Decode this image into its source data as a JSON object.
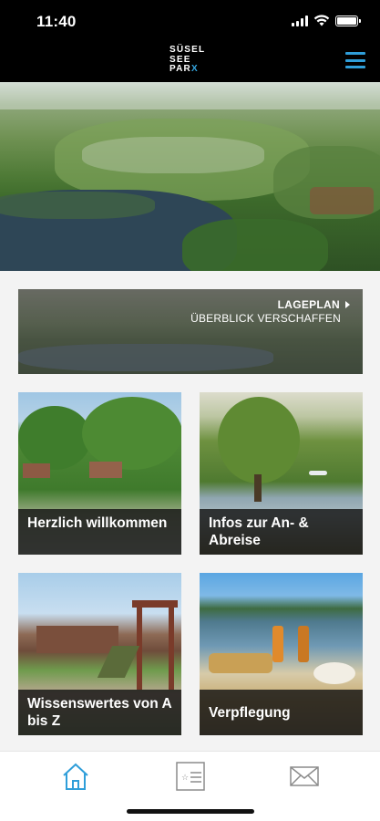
{
  "status_bar": {
    "time": "11:40"
  },
  "header": {
    "logo_lines": [
      "SÜSEL",
      "SEE",
      "PAR"
    ],
    "logo_accent": "X",
    "menu_icon": "hamburger-menu-icon",
    "accent_color": "#2f9ed9"
  },
  "hero": {
    "image": "aerial-view-campsite-lake"
  },
  "lageplan": {
    "title": "LAGEPLAN",
    "subtitle": "ÜBERBLICK VERSCHAFFEN"
  },
  "tiles": [
    {
      "label": "Herzlich willkommen",
      "image": "cabins-by-lake"
    },
    {
      "label": "Infos zur An- & Abreise",
      "image": "willow-tree-lakeside"
    },
    {
      "label": "Wissenswertes von A bis Z",
      "image": "playground"
    },
    {
      "label": "Verpflegung",
      "image": "drinks-and-food-by-lake"
    }
  ],
  "tab_bar": {
    "items": [
      {
        "icon": "home-icon",
        "active": true
      },
      {
        "icon": "id-card-icon",
        "active": false
      },
      {
        "icon": "mail-icon",
        "active": false
      }
    ],
    "active_color": "#2f9ed9",
    "inactive_color": "#8c8c8c"
  }
}
